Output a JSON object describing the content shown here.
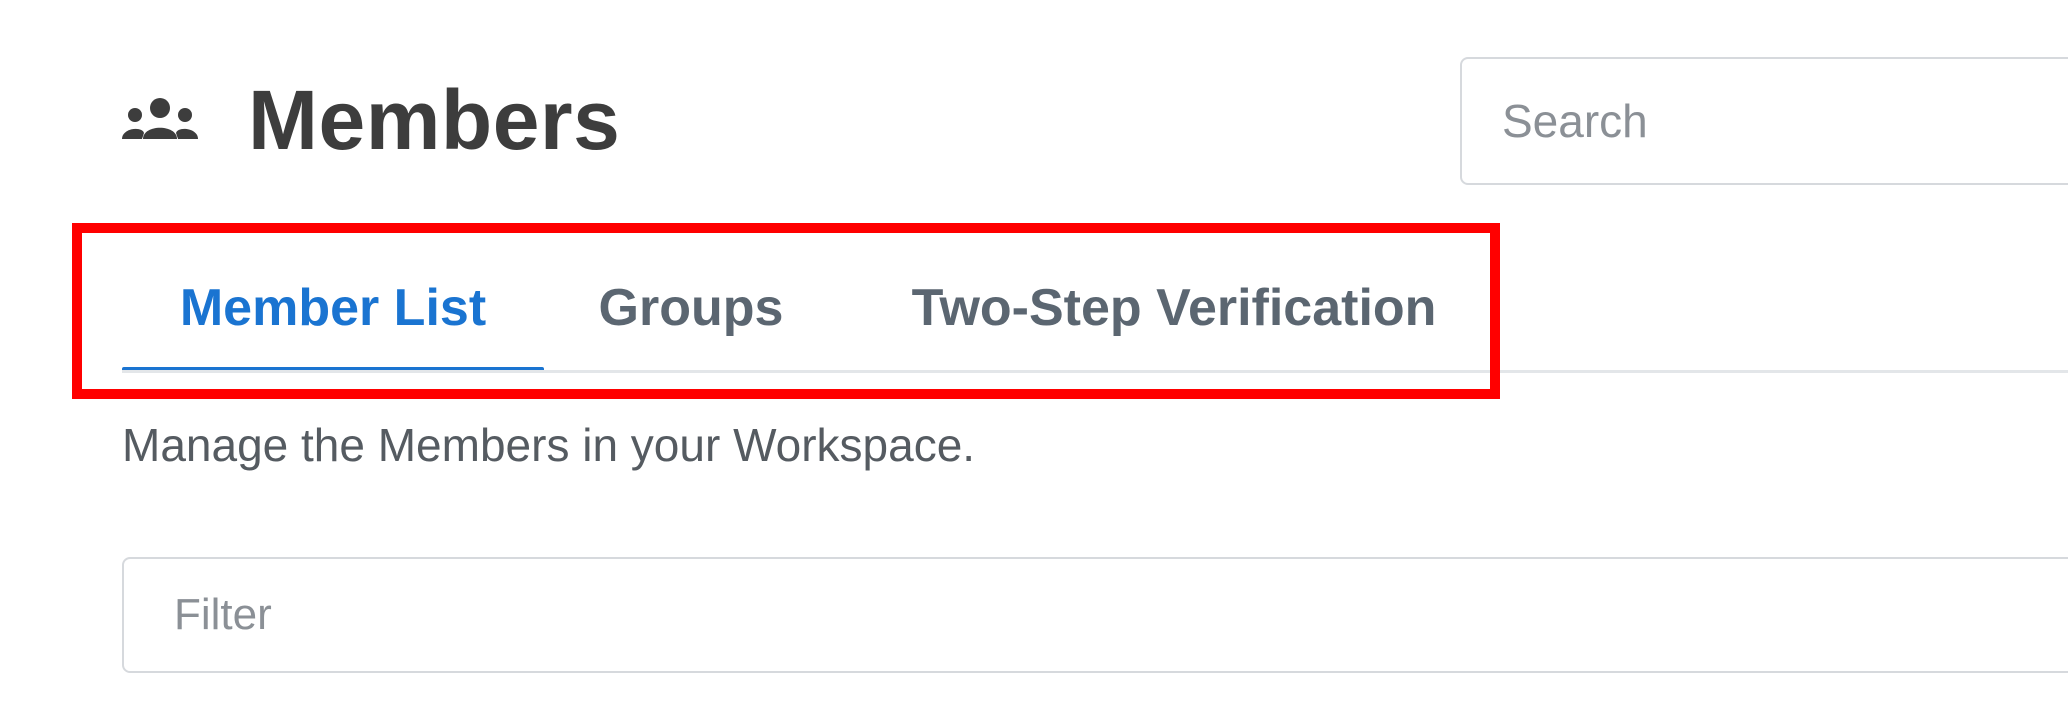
{
  "header": {
    "icon": "members-icon",
    "title": "Members"
  },
  "search": {
    "placeholder": "Search"
  },
  "tabs": [
    {
      "label": "Member List",
      "active": true
    },
    {
      "label": "Groups",
      "active": false
    },
    {
      "label": "Two-Step Verification",
      "active": false
    }
  ],
  "description": "Manage the Members in your Workspace.",
  "filter": {
    "placeholder": "Filter"
  },
  "colors": {
    "accent": "#1a74d1",
    "highlight": "#ff0000",
    "title": "#3d3d3d"
  }
}
